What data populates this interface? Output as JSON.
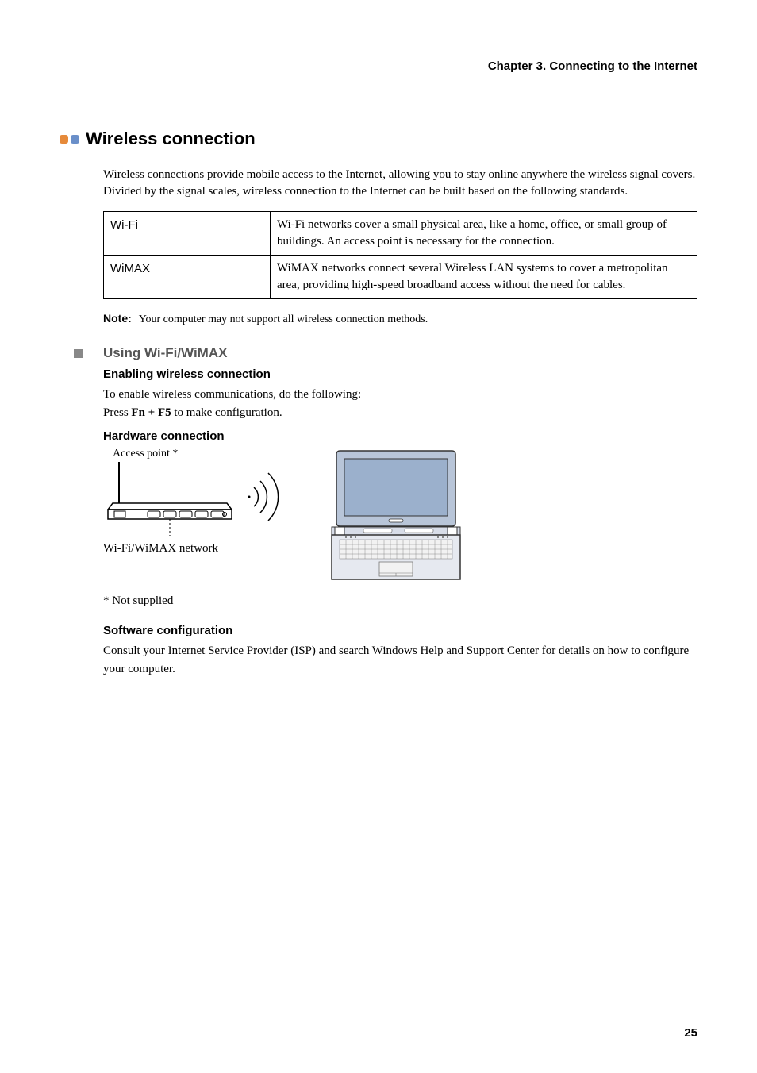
{
  "chapterHeader": "Chapter 3. Connecting to the Internet",
  "section": {
    "title": "Wireless connection",
    "intro1": "Wireless connections provide mobile access to the Internet, allowing you to stay online anywhere the wireless signal covers.",
    "intro2": "Divided by the signal scales, wireless connection to the Internet can be built based on the following standards."
  },
  "table": {
    "rows": [
      {
        "label": "Wi-Fi",
        "desc": "Wi-Fi networks cover a small physical area, like a home, office, or small group of buildings. An access point is necessary for the connection."
      },
      {
        "label": "WiMAX",
        "desc": "WiMAX networks connect several Wireless LAN systems to cover a metropolitan area, providing high-speed broadband access without the need for cables."
      }
    ]
  },
  "note": {
    "label": "Note:",
    "text": "Your computer may not support all wireless connection methods."
  },
  "sub": {
    "heading": "Using Wi-Fi/WiMAX"
  },
  "enable": {
    "heading": "Enabling wireless connection",
    "line1": "To enable wireless communications, do the following:",
    "line2a": "Press ",
    "line2b": "Fn + F5",
    "line2c": " to make configuration."
  },
  "hardware": {
    "heading": "Hardware connection",
    "accessPointLabel": "Access point *",
    "networkLabel": "Wi-Fi/WiMAX network",
    "notSupplied": "* Not supplied"
  },
  "software": {
    "heading": "Software configuration",
    "body": "Consult your Internet Service Provider (ISP) and search Windows Help and Support Center for details on how to configure your computer."
  },
  "pageNumber": "25"
}
